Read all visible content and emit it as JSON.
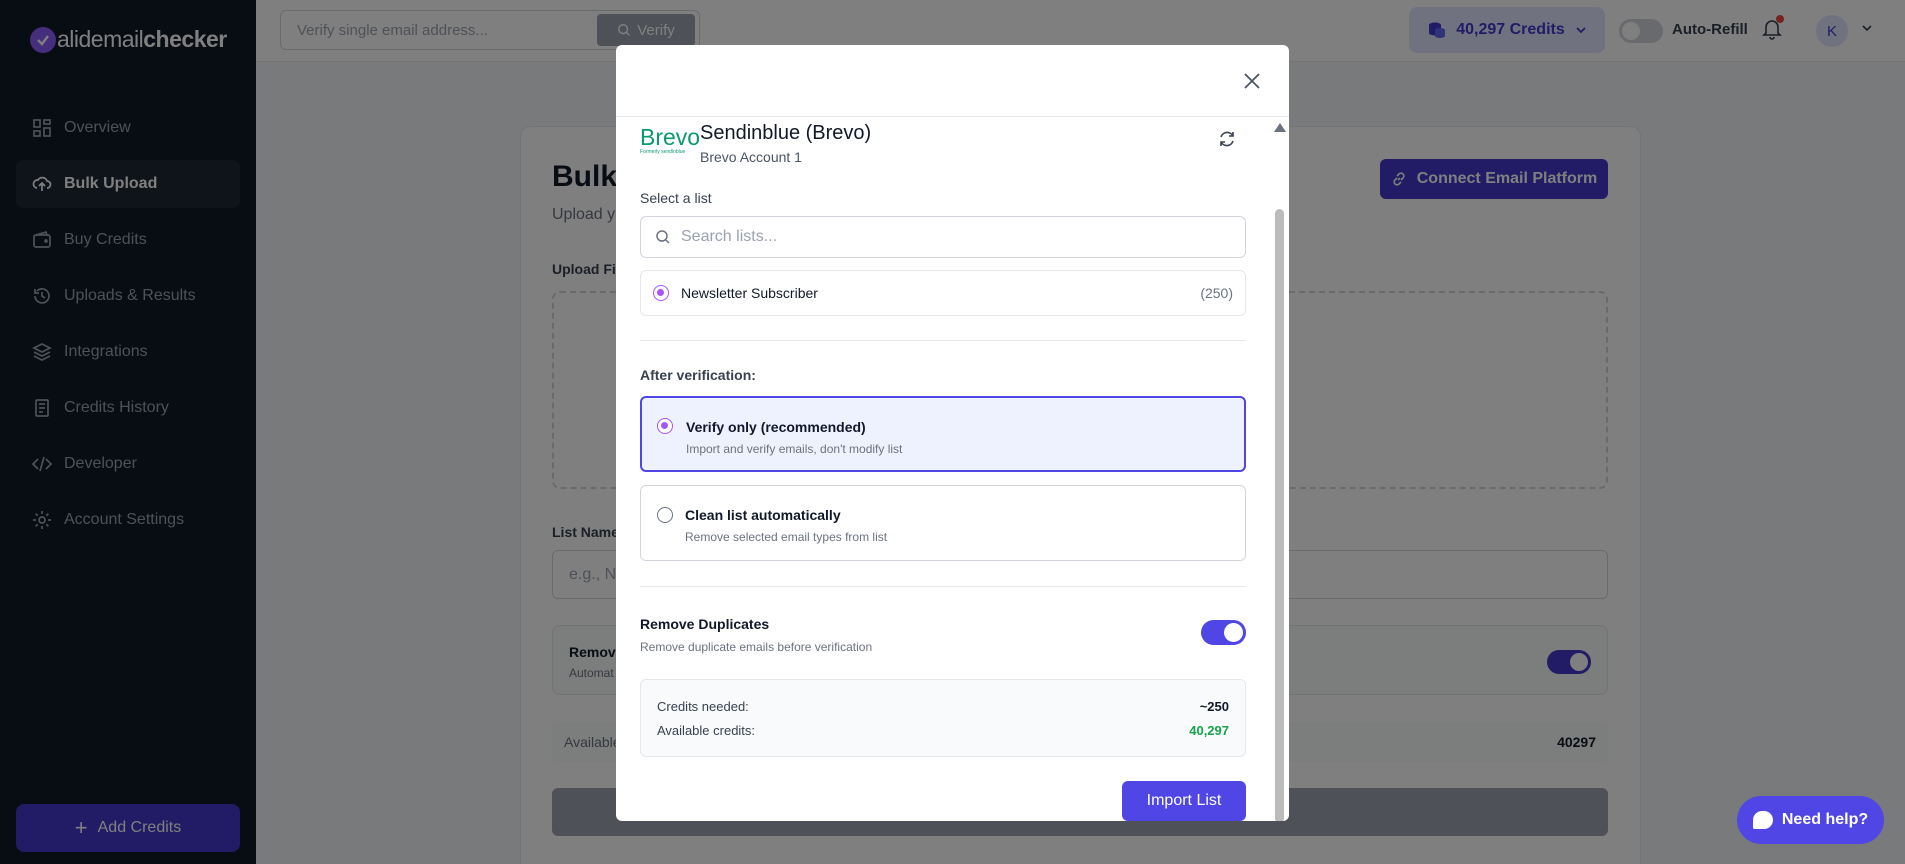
{
  "brand": {
    "logo_text_light": "alidemail",
    "logo_text_bold": "checker"
  },
  "sidebar": {
    "items": [
      {
        "label": "Overview",
        "icon": "grid-icon"
      },
      {
        "label": "Bulk Upload",
        "icon": "cloud-upload-icon"
      },
      {
        "label": "Buy Credits",
        "icon": "wallet-icon"
      },
      {
        "label": "Uploads & Results",
        "icon": "history-icon"
      },
      {
        "label": "Integrations",
        "icon": "layers-icon"
      },
      {
        "label": "Credits History",
        "icon": "receipt-icon"
      },
      {
        "label": "Developer",
        "icon": "code-icon"
      },
      {
        "label": "Account Settings",
        "icon": "gear-icon"
      }
    ],
    "add_credits": "Add Credits"
  },
  "header": {
    "verify_placeholder": "Verify single email address...",
    "verify_button": "Verify",
    "credits": "40,297 Credits",
    "auto_refill": "Auto-Refill",
    "avatar_initial": "K"
  },
  "page": {
    "title": "Bulk",
    "subtitle": "Upload y",
    "connect_button": "Connect Email Platform",
    "upload_label": "Upload Fil",
    "list_name_label": "List Name",
    "list_name_placeholder": "e.g., Ne",
    "remove_title": "Remove",
    "remove_sub": "Automat",
    "available_label": "Available",
    "available_value": "40297"
  },
  "modal": {
    "integration": {
      "logo_text": "Brevo",
      "logo_small": "Formerly sendinblue",
      "name": "Sendinblue (Brevo)",
      "account": "Brevo Account 1"
    },
    "select_list_label": "Select a list",
    "search_placeholder": "Search lists...",
    "lists": [
      {
        "name": "Newsletter Subscriber",
        "count": "(250)"
      }
    ],
    "after_label": "After verification:",
    "options": [
      {
        "title": "Verify only (recommended)",
        "subtitle": "Import and verify emails, don't modify list"
      },
      {
        "title": "Clean list automatically",
        "subtitle": "Remove selected email types from list"
      }
    ],
    "duplicates": {
      "title": "Remove Duplicates",
      "subtitle": "Remove duplicate emails before verification"
    },
    "summary": {
      "credits_needed_label": "Credits needed:",
      "credits_needed_value": "~250",
      "available_label": "Available credits:",
      "available_value": "40,297"
    },
    "import_button": "Import List"
  },
  "help_button": "Need help?",
  "colors": {
    "accent": "#4f46e5",
    "sidebar_bg": "#111827",
    "radio": "#a855f7",
    "success": "#16a34a"
  }
}
